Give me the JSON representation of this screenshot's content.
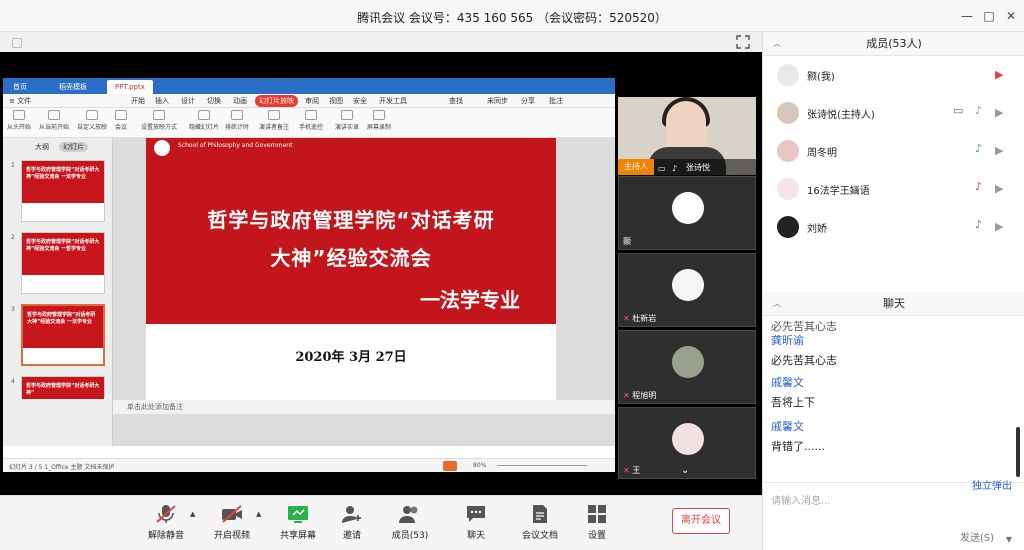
{
  "window": {
    "title": "腾讯会议 会议号：435 160 565 （会议密码：520520）",
    "controls": [
      "—",
      "□",
      "✕"
    ]
  },
  "shared_screen": {
    "tabs": [
      "首页",
      "稻壳模板",
      "PPT.pptx"
    ],
    "menu": [
      "≡ 文件",
      "开始",
      "插入",
      "设计",
      "切换",
      "动画",
      "幻灯片放映",
      "审阅",
      "视图",
      "安全",
      "开发工具",
      "查找"
    ],
    "menu_right": [
      "未同步",
      "分享",
      "批注"
    ],
    "ribbon": [
      "从头开始",
      "从当前开始",
      "自定义放映",
      "会议",
      "设置放映方式",
      "隐藏幻灯片",
      "排练计时",
      "演讲者备注",
      "手机遥控",
      "演讲实录",
      "屏幕录制"
    ],
    "pane_tabs": [
      "大纲",
      "幻灯片"
    ],
    "thumbnails": [
      {
        "num": "1",
        "text": "哲学与政府管理学院“对话考研大神”经验交流会 一法学专业"
      },
      {
        "num": "2",
        "text": "哲学与政府管理学院“对话考研大神”经验交流会 一哲学专业"
      },
      {
        "num": "3",
        "text": "哲学与政府管理学院“对话考研大神”经验交流会 一法学专业"
      },
      {
        "num": "4",
        "text": "哲学与政府管理学院“对话考研大神”"
      }
    ],
    "slide": {
      "school": "School of Philosophy and Government",
      "line1": "哲学与政府管理学院“对话考研",
      "line2": "大神”经验交流会",
      "line3": "一法学专业",
      "date": "2020年 3月 27日"
    },
    "notes": "单击此处添加备注",
    "status_left": "幻灯片 3 / 5   1_Office 主题   文档未保护",
    "zoom": "80%"
  },
  "video_tiles": [
    {
      "name": "张诗悦",
      "badge": "主持人"
    },
    {
      "name": "颢"
    },
    {
      "name": "杜新岩"
    },
    {
      "name": "程旭明"
    },
    {
      "name": "王"
    }
  ],
  "members": {
    "title": "成员(53人)",
    "list": [
      {
        "name": "颢(我)"
      },
      {
        "name": "张诗悦(主持人)"
      },
      {
        "name": "周冬明"
      },
      {
        "name": "16法学王婳语"
      },
      {
        "name": "刘娇"
      }
    ]
  },
  "chat": {
    "title": "聊天",
    "messages": [
      {
        "user": "",
        "text": "必先苦其心志"
      },
      {
        "user": "龚昕谕",
        "text": "必先苦其心志"
      },
      {
        "user": "戚馨文",
        "text": "吾将上下"
      },
      {
        "user": "戚馨文",
        "text": "背错了......"
      }
    ],
    "popout": "独立弹出",
    "input_placeholder": "请输入消息...",
    "send": "发送(S)"
  },
  "toolbar": {
    "unmute": "解除静音",
    "video": "开启视频",
    "share": "共享屏幕",
    "invite": "邀请",
    "members": "成员(53)",
    "chat": "聊天",
    "docs": "会议文档",
    "settings": "设置",
    "leave": "离开会议"
  }
}
